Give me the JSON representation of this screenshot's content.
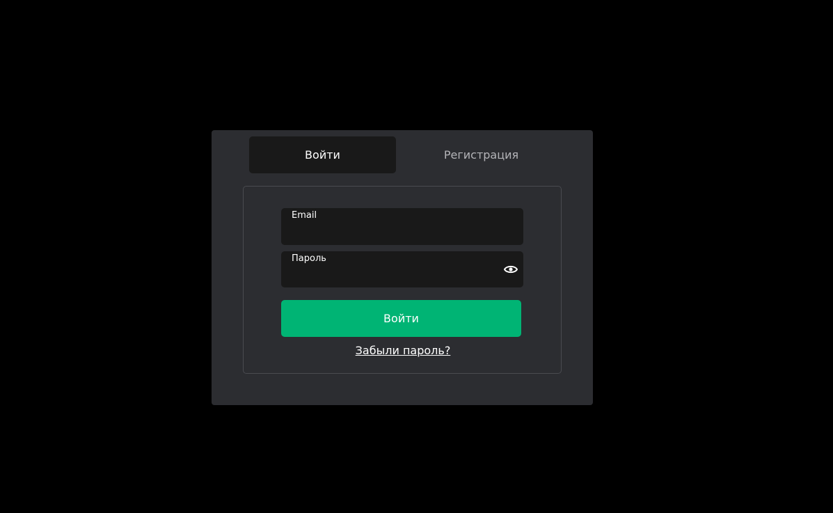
{
  "tabs": {
    "login_label": "Войти",
    "register_label": "Регистрация"
  },
  "form": {
    "email_label": "Email",
    "email_value": "",
    "password_label": "Пароль",
    "password_value": "",
    "password_toggle_icon": "eye-icon",
    "submit_label": "Войти",
    "forgot_label": "Забыли пароль?"
  },
  "colors": {
    "background": "#000000",
    "modal": "#2c2d31",
    "field": "#191919",
    "accent": "#00b474"
  }
}
